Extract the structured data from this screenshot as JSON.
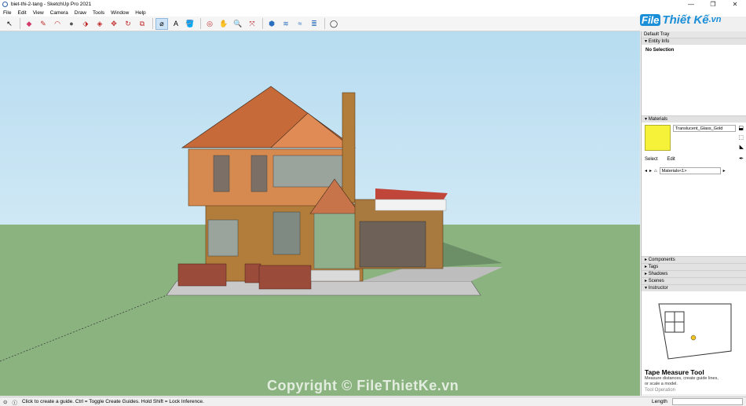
{
  "window": {
    "title": "biet-thi-2-tang - SketchUp Pro 2021",
    "minimize": "—",
    "maximize": "❐",
    "close": "✕"
  },
  "menu": [
    "File",
    "Edit",
    "View",
    "Camera",
    "Draw",
    "Tools",
    "Window",
    "Help"
  ],
  "logo": {
    "mark": "File",
    "text": "Thiết Kế",
    "suffix": ".vn"
  },
  "tray": {
    "title": "Default Tray",
    "entity_info": {
      "label": "Entity Info",
      "selection": "No Selection"
    },
    "materials": {
      "label": "Materials",
      "material_name": "Translucent_Glass_Gold",
      "swatch_color": "#f6f23a",
      "tab_select": "Select",
      "tab_edit": "Edit",
      "library": "Materials<1>"
    },
    "collapsed_panels": [
      "Components",
      "Tags",
      "Shadows",
      "Scenes"
    ],
    "instructor": {
      "label": "Instructor",
      "tool_title": "Tape Measure Tool",
      "tool_desc": "Measure distances, create guide lines, or scale a model.",
      "next_heading": "Tool Operation"
    }
  },
  "statusbar": {
    "hint": "Click to create a guide. Ctrl = Toggle Create Guides. Hold Shift = Lock Inference.",
    "measure_label": "Length",
    "measure_value": ""
  },
  "watermark": "Copyright © FileThietKe.vn",
  "colors": {
    "sky": "#c4e3f3",
    "ground": "#8bb380",
    "accent": "#1a8fd8"
  }
}
